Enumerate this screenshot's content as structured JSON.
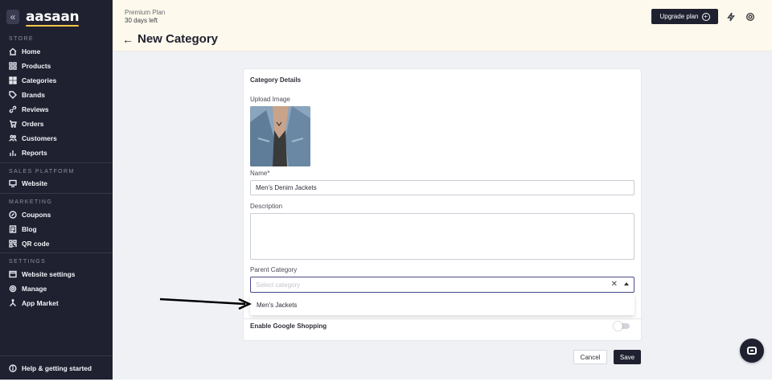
{
  "sidebar": {
    "logo": "aasaan",
    "collapse_icon": "double-chevron-left-icon",
    "sections": [
      {
        "label": "STORE"
      },
      {
        "label": "SALES PLATFORM"
      },
      {
        "label": "MARKETING"
      },
      {
        "label": "SETTINGS"
      }
    ],
    "items": [
      {
        "label": "Home",
        "icon": "home-icon"
      },
      {
        "label": "Products",
        "icon": "grid-icon"
      },
      {
        "label": "Categories",
        "icon": "categories-icon"
      },
      {
        "label": "Brands",
        "icon": "tag-icon"
      },
      {
        "label": "Reviews",
        "icon": "link-icon"
      },
      {
        "label": "Orders",
        "icon": "cart-icon"
      },
      {
        "label": "Customers",
        "icon": "users-icon"
      },
      {
        "label": "Reports",
        "icon": "bar-chart-icon"
      },
      {
        "label": "Website",
        "icon": "monitor-icon"
      },
      {
        "label": "Coupons",
        "icon": "percent-icon"
      },
      {
        "label": "Blog",
        "icon": "document-icon"
      },
      {
        "label": "QR code",
        "icon": "qr-icon"
      },
      {
        "label": "Website settings",
        "icon": "browser-icon"
      },
      {
        "label": "Manage",
        "icon": "gear-icon"
      },
      {
        "label": "App Market",
        "icon": "apps-icon"
      }
    ],
    "help": {
      "label": "Help & getting started",
      "icon": "help-icon"
    }
  },
  "topbar": {
    "plan_name": "Premium Plan",
    "plan_days": "30 days left",
    "upgrade_label": "Upgrade plan",
    "page_title": "New Category"
  },
  "form": {
    "card_title": "Category Details",
    "upload_label": "Upload Image",
    "name_label": "Name*",
    "name_value": "Men's Denim Jackets",
    "description_label": "Description",
    "description_value": "",
    "parent_label": "Parent Category",
    "parent_placeholder": "Select category",
    "dropdown_options": [
      "Men's Jackets"
    ],
    "google_shopping_label": "Enable Google Shopping",
    "google_shopping_enabled": false
  },
  "actions": {
    "cancel_label": "Cancel",
    "save_label": "Save"
  },
  "colors": {
    "sidebar_bg": "#1f2130",
    "banner_bg": "#fdf9ec",
    "main_bg": "#eff1f5",
    "accent": "#f6c546"
  }
}
